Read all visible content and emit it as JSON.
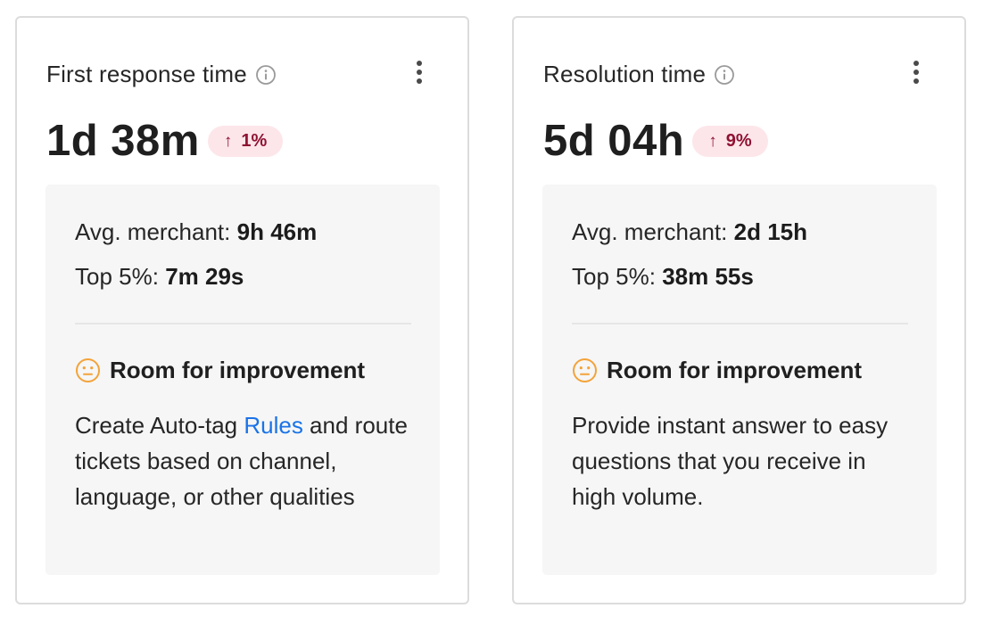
{
  "cards": [
    {
      "title": "First response time",
      "value": "1d 38m",
      "delta": {
        "arrow": "↑",
        "text": "1%"
      },
      "benchmarks": {
        "avg_label": "Avg. merchant:",
        "avg_value": "9h 46m",
        "top_label": "Top 5%:",
        "top_value": "7m 29s"
      },
      "status": {
        "icon": "neutral-face-icon",
        "label": "Room for improvement"
      },
      "advice": {
        "before_link": "Create Auto-tag ",
        "link": "Rules",
        "after_link": " and route tickets based on channel, language, or other qualities"
      }
    },
    {
      "title": "Resolution time",
      "value": "5d 04h",
      "delta": {
        "arrow": "↑",
        "text": "9%"
      },
      "benchmarks": {
        "avg_label": "Avg. merchant:",
        "avg_value": "2d 15h",
        "top_label": "Top 5%:",
        "top_value": "38m 55s"
      },
      "status": {
        "icon": "neutral-face-icon",
        "label": "Room for improvement"
      },
      "advice": {
        "text": "Provide instant answer to easy questions that you receive in high volume."
      }
    }
  ],
  "colors": {
    "badge_bg": "#fde6ea",
    "badge_text": "#8f1232",
    "link": "#1a73e8",
    "face": "#f3a33a",
    "panel_bg": "#f6f6f6"
  }
}
